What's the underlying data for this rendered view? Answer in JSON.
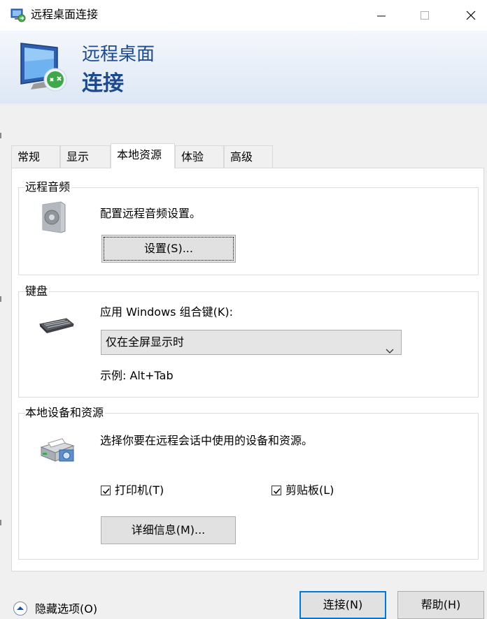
{
  "window": {
    "title": "远程桌面连接"
  },
  "banner": {
    "line1": "远程桌面",
    "line2": "连接"
  },
  "tabs": [
    {
      "label": "常规",
      "active": false
    },
    {
      "label": "显示",
      "active": false
    },
    {
      "label": "本地资源",
      "active": true
    },
    {
      "label": "体验",
      "active": false
    },
    {
      "label": "高级",
      "active": false
    }
  ],
  "audio": {
    "legend": "远程音频",
    "description": "配置远程音频设置。",
    "settings_button": "设置(S)..."
  },
  "keyboard": {
    "legend": "键盘",
    "label": "应用 Windows 组合键(K):",
    "selected": "仅在全屏显示时",
    "example": "示例: Alt+Tab"
  },
  "devices": {
    "legend": "本地设备和资源",
    "description": "选择你要在远程会话中使用的设备和资源。",
    "printer_label": "打印机(T)",
    "printer_checked": true,
    "clipboard_label": "剪贴板(L)",
    "clipboard_checked": true,
    "details_button": "详细信息(M)..."
  },
  "footer": {
    "hide_options": "隐藏选项(O)",
    "connect_button": "连接(N)",
    "help_button": "帮助(H)"
  },
  "icons": {
    "app": "remote-desktop-icon",
    "banner": "monitor-connection-icon",
    "audio": "speaker-icon",
    "keyboard": "keyboard-icon",
    "devices": "printer-devices-icon",
    "collapse": "chevron-up-circle-icon"
  },
  "colors": {
    "accent": "#0078d7",
    "banner_text": "#1c4a8c"
  }
}
